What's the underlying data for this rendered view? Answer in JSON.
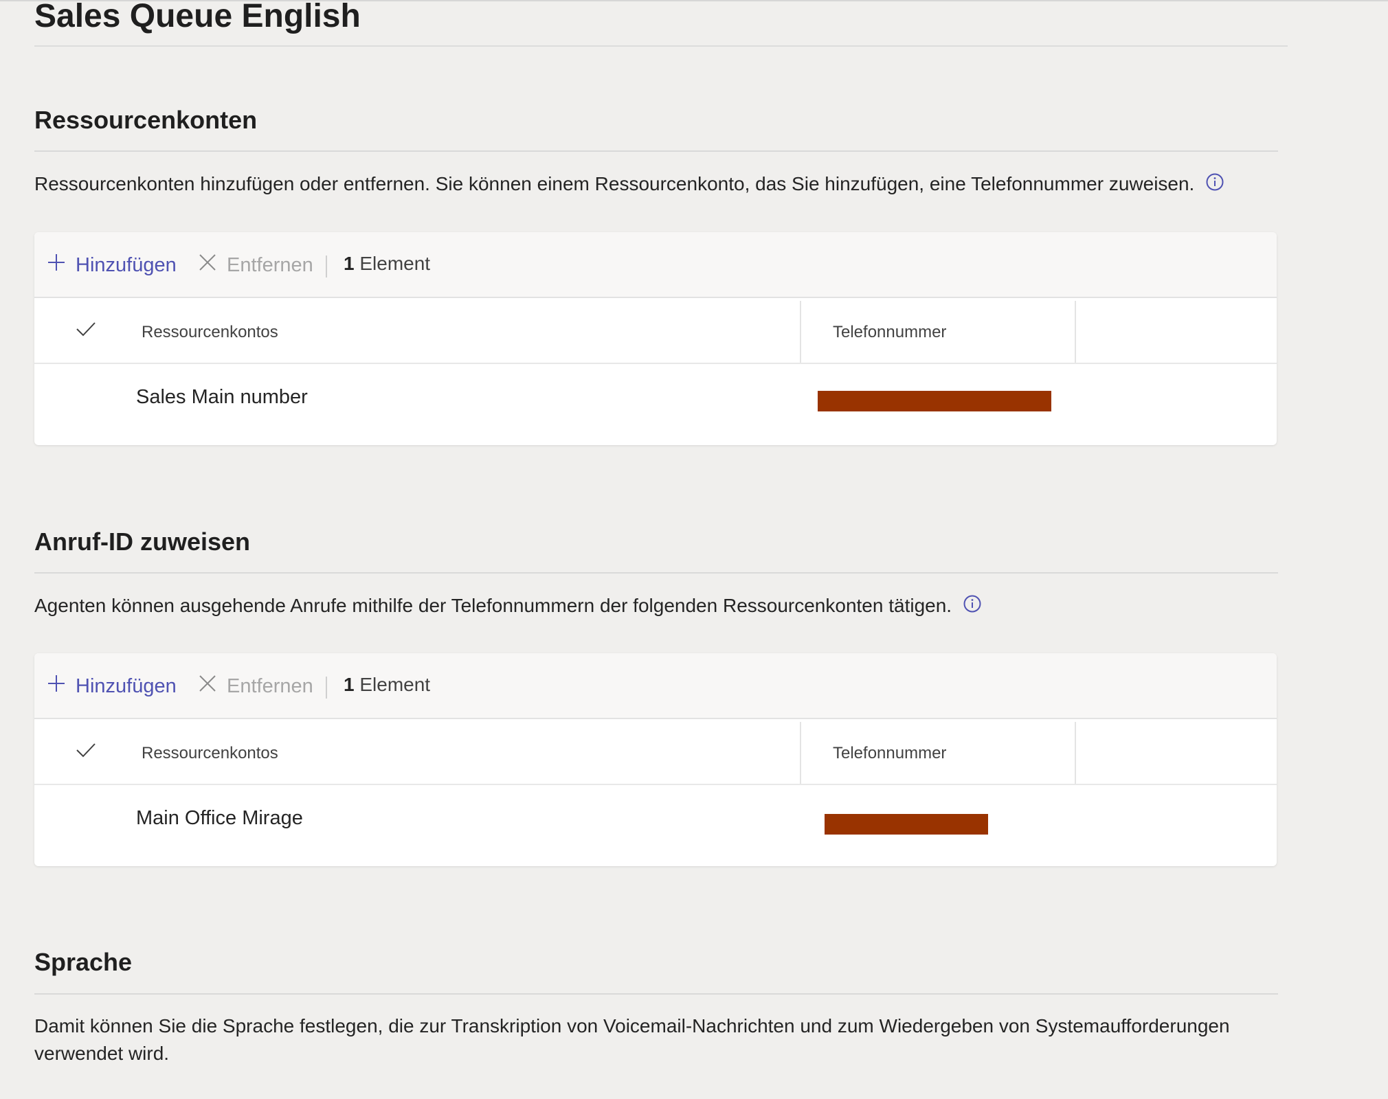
{
  "page": {
    "title": "Sales Queue English"
  },
  "resource_accounts": {
    "title": "Ressourcenkonten",
    "description": "Ressourcenkonten hinzufügen oder entfernen. Sie können einem Ressourcenkonto, das Sie hinzufügen, eine Telefonnummer zuweisen.",
    "toolbar": {
      "add_label": "Hinzufügen",
      "remove_label": "Entfernen",
      "count_number": "1",
      "count_label": "Element"
    },
    "columns": [
      "Ressourcenkontos",
      "Telefonnummer"
    ],
    "rows": [
      {
        "name": "Sales Main number",
        "phone": "redacted"
      }
    ]
  },
  "caller_id": {
    "title": "Anruf-ID zuweisen",
    "description": "Agenten können ausgehende Anrufe mithilfe der Telefonnummern der folgenden Ressourcenkonten tätigen.",
    "toolbar": {
      "add_label": "Hinzufügen",
      "remove_label": "Entfernen",
      "count_number": "1",
      "count_label": "Element"
    },
    "columns": [
      "Ressourcenkontos",
      "Telefonnummer"
    ],
    "rows": [
      {
        "name": "Main Office Mirage",
        "phone": "redacted"
      }
    ]
  },
  "language": {
    "title": "Sprache",
    "description": "Damit können Sie die Sprache festlegen, die zur Transkription von Voicemail-Nachrichten und zum Wiedergeben von Systemaufforderungen verwendet wird."
  },
  "colors": {
    "accent": "#4f52b2",
    "disabled": "#a6a6a6",
    "redaction": "#993300",
    "background": "#f0efed"
  },
  "icons": [
    "add-icon",
    "remove-icon",
    "checkmark-icon",
    "info-icon"
  ]
}
